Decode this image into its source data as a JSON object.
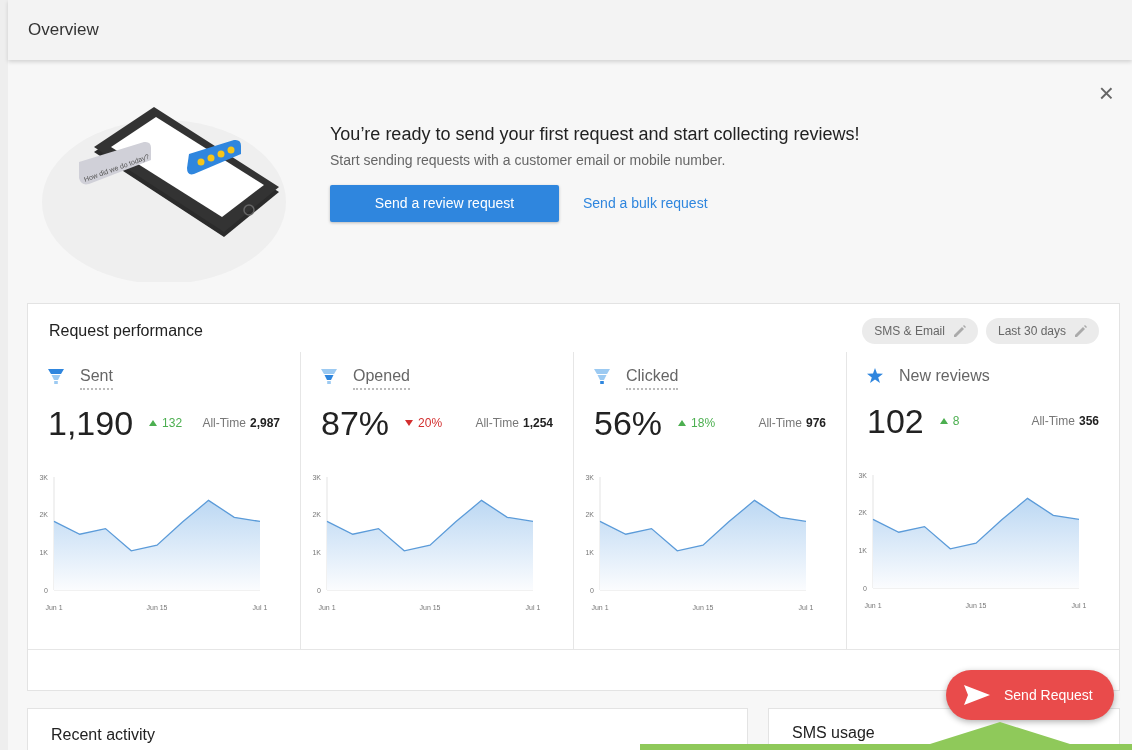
{
  "header": {
    "title": "Overview"
  },
  "banner": {
    "bubble_text": "How did we do today?",
    "title": "You’re ready to send your first request and start collecting reviews!",
    "subtitle": "Start sending requests with a customer email or mobile number.",
    "primary_button": "Send a review request",
    "link": "Send a bulk request",
    "close": "×"
  },
  "performance": {
    "title": "Request performance",
    "filters": [
      "SMS & Email",
      "Last 30 days"
    ],
    "metrics": [
      {
        "kind": "funnel-top",
        "label": "Sent",
        "underlined": true,
        "value": "1,190",
        "increase": true,
        "delta": "132",
        "all_time_label": "All-Time",
        "all_time": "2,987",
        "chart_data": {
          "type": "area",
          "categories": [
            "Jun 1",
            null,
            null,
            null,
            "Jun 15",
            null,
            null,
            null,
            "Jul 1"
          ],
          "values": [
            1820,
            1480,
            1630,
            1040,
            1190,
            1810,
            2380,
            1930,
            1820
          ],
          "ylim": [
            0,
            3000
          ],
          "yticks": [
            {
              "value": 0,
              "label": "0"
            },
            {
              "value": 1000,
              "label": "1K"
            },
            {
              "value": 2000,
              "label": "2K"
            },
            {
              "value": 3000,
              "label": "3K"
            }
          ]
        }
      },
      {
        "kind": "funnel-middle",
        "label": "Opened",
        "underlined": true,
        "value": "87%",
        "increase": false,
        "delta": "20%",
        "all_time_label": "All-Time",
        "all_time": "1,254",
        "chart_data": {
          "type": "area",
          "categories": [
            "Jun 1",
            null,
            null,
            null,
            "Jun 15",
            null,
            null,
            null,
            "Jul 1"
          ],
          "values": [
            1820,
            1480,
            1630,
            1040,
            1190,
            1810,
            2380,
            1930,
            1820
          ],
          "ylim": [
            0,
            3000
          ],
          "yticks": [
            {
              "value": 0,
              "label": "0"
            },
            {
              "value": 1000,
              "label": "1K"
            },
            {
              "value": 2000,
              "label": "2K"
            },
            {
              "value": 3000,
              "label": "3K"
            }
          ]
        }
      },
      {
        "kind": "funnel-bottom",
        "label": "Clicked",
        "underlined": true,
        "value": "56%",
        "increase": true,
        "delta": "18%",
        "all_time_label": "All-Time",
        "all_time": "976",
        "chart_data": {
          "type": "area",
          "categories": [
            "Jun 1",
            null,
            null,
            null,
            "Jun 15",
            null,
            null,
            null,
            "Jul 1"
          ],
          "values": [
            1820,
            1480,
            1630,
            1040,
            1190,
            1810,
            2380,
            1930,
            1820
          ],
          "ylim": [
            0,
            3000
          ],
          "yticks": [
            {
              "value": 0,
              "label": "0"
            },
            {
              "value": 1000,
              "label": "1K"
            },
            {
              "value": 2000,
              "label": "2K"
            },
            {
              "value": 3000,
              "label": "3K"
            }
          ]
        }
      },
      {
        "kind": "star",
        "label": "New reviews",
        "underlined": false,
        "value": "102",
        "increase": true,
        "delta": "8",
        "all_time_label": "All-Time",
        "all_time": "356",
        "chart_data": {
          "type": "area",
          "categories": [
            "Jun 1",
            null,
            null,
            null,
            "Jun 15",
            null,
            null,
            null,
            "Jul 1"
          ],
          "values": [
            1820,
            1480,
            1630,
            1040,
            1190,
            1810,
            2380,
            1930,
            1820
          ],
          "ylim": [
            0,
            3000
          ],
          "yticks": [
            {
              "value": 0,
              "label": "0"
            },
            {
              "value": 1000,
              "label": "1K"
            },
            {
              "value": 2000,
              "label": "2K"
            },
            {
              "value": 3000,
              "label": "3K"
            }
          ]
        }
      }
    ]
  },
  "recent_activity": {
    "title": "Recent activity"
  },
  "sms_usage": {
    "title": "SMS usage"
  },
  "fab": {
    "label": "Send Request"
  }
}
